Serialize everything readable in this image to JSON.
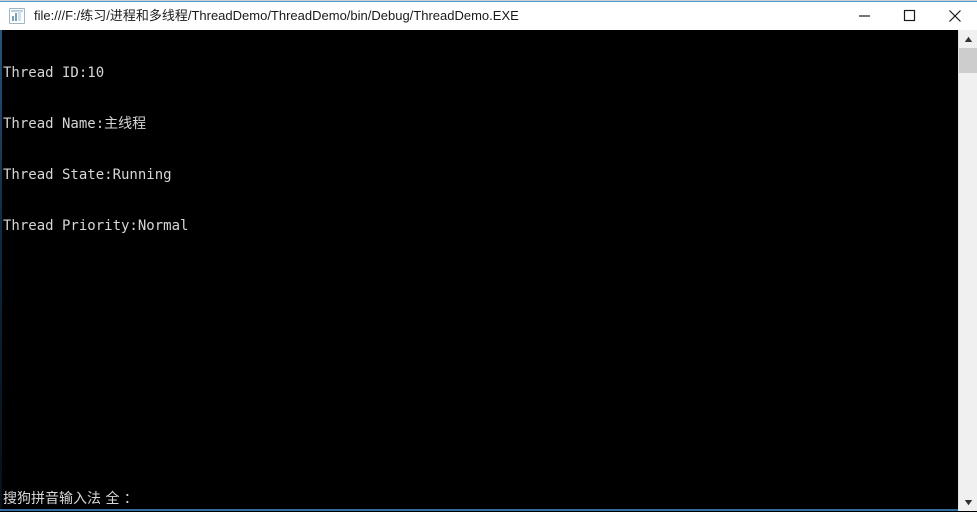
{
  "window": {
    "title": "file:///F:/练习/进程和多线程/ThreadDemo/ThreadDemo/bin/Debug/ThreadDemo.EXE",
    "icon": "console-app-icon",
    "titlebar_background": "#ffffff",
    "titlebar_text_color": "#1a1a1a",
    "accent_color": "#4a9ad4"
  },
  "controls": {
    "minimize_label": "Minimize",
    "maximize_label": "Maximize",
    "close_label": "Close"
  },
  "console": {
    "background": "#000000",
    "foreground": "#d6d6d6",
    "lines": [
      "Thread ID:10",
      "Thread Name:主线程",
      "Thread State:Running",
      "Thread Priority:Normal"
    ]
  },
  "ime": {
    "status_text": "搜狗拼音输入法 全 ："
  },
  "scrollbar": {
    "up_arrow": "chevron-up-icon",
    "down_arrow": "chevron-down-icon",
    "thumb_color": "#cdcdcd",
    "track_color": "#f0f0f0"
  }
}
